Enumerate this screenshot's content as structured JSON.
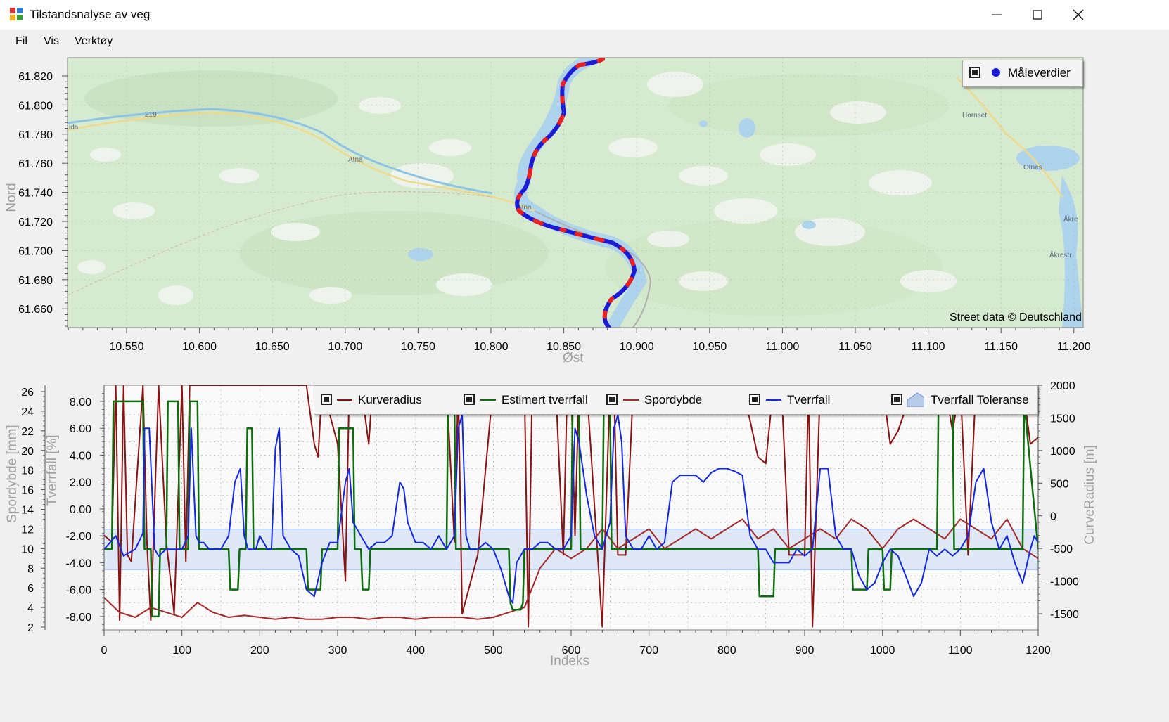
{
  "window": {
    "title": "Tilstandsnalyse av veg",
    "controls": {
      "minimize": "minimize-icon",
      "maximize": "maximize-icon",
      "close": "close-icon"
    }
  },
  "menu": {
    "items": [
      "Fil",
      "Vis",
      "Verktøy"
    ]
  },
  "map": {
    "y_axis_label": "Nord",
    "x_axis_label": "Øst",
    "y_ticks": [
      "61.820",
      "61.800",
      "61.780",
      "61.760",
      "61.740",
      "61.720",
      "61.700",
      "61.680",
      "61.660"
    ],
    "x_ticks": [
      "10.550",
      "10.600",
      "10.650",
      "10.700",
      "10.750",
      "10.800",
      "10.850",
      "10.900",
      "10.950",
      "11.000",
      "11.050",
      "11.100",
      "11.150",
      "11.200"
    ],
    "legend_label": "Måleverdier",
    "attribution": "Street data © Deutschland",
    "place_labels": [
      "Atna",
      "Atna",
      "Hornset",
      "Otnes",
      "Åkre",
      "Åkrestr",
      "ida",
      "219"
    ],
    "colors": {
      "land": "#d6ead0",
      "water": "#aed3ec",
      "route_blue": "#1a1ad8",
      "route_red": "#ee1f1f",
      "road": "#efd98a"
    }
  },
  "chart": {
    "legend": [
      "Kurveradius",
      "Estimert tverrfall",
      "Spordybde",
      "Tverrfall",
      "Tverrfall Toleranse"
    ],
    "x_axis_label": "Indeks",
    "x_ticks": [
      "0",
      "100",
      "200",
      "300",
      "400",
      "500",
      "600",
      "700",
      "800",
      "900",
      "1000",
      "1100",
      "1200"
    ],
    "left_axis_outer_label": "Spordybde [mm]",
    "left_axis_outer_ticks": [
      "26",
      "24",
      "22",
      "20",
      "18",
      "16",
      "14",
      "12",
      "10",
      "8",
      "6",
      "4",
      "2"
    ],
    "left_axis_inner_label": "Tverrfall [%]",
    "left_axis_inner_ticks": [
      "8.00",
      "6.00",
      "4.00",
      "2.00",
      "0.00",
      "-2.00",
      "-4.00",
      "-6.00",
      "-8.00"
    ],
    "right_axis_label": "CurveRadius [m]",
    "right_axis_ticks": [
      "2000",
      "1500",
      "1000",
      "500",
      "0",
      "-500",
      "-1000",
      "-1500"
    ],
    "colors": {
      "kurveradius": "#8b1212",
      "estimert": "#0c6e0c",
      "spordybde": "#a52a2a",
      "tverrfall": "#1428e0",
      "toleranse_fill": "#dbe5f5",
      "toleranse_line": "#6d94de"
    }
  },
  "chart_data": {
    "type": "line",
    "x_range": [
      0,
      1200
    ],
    "tverrfall_range": [
      -9,
      9.2
    ],
    "series": [
      {
        "name": "Tverrfall",
        "axis": "Tverrfall [%]",
        "x": [
          0,
          15,
          25,
          40,
          50,
          52,
          58,
          65,
          70,
          80,
          90,
          100,
          108,
          112,
          118,
          122,
          128,
          135,
          140,
          150,
          160,
          168,
          175,
          180,
          185,
          195,
          200,
          210,
          215,
          220,
          225,
          230,
          240,
          250,
          260,
          270,
          280,
          290,
          300,
          310,
          315,
          320,
          330,
          340,
          350,
          360,
          370,
          380,
          385,
          390,
          400,
          410,
          420,
          430,
          440,
          450,
          455,
          460,
          465,
          470,
          480,
          490,
          500,
          510,
          520,
          525,
          530,
          540,
          550,
          560,
          570,
          580,
          590,
          600,
          605,
          610,
          620,
          630,
          640,
          650,
          655,
          660,
          665,
          670,
          680,
          690,
          700,
          710,
          720,
          730,
          740,
          750,
          760,
          770,
          780,
          790,
          800,
          810,
          820,
          830,
          840,
          850,
          860,
          870,
          880,
          890,
          900,
          910,
          920,
          930,
          940,
          950,
          960,
          970,
          980,
          990,
          1000,
          1010,
          1020,
          1030,
          1040,
          1050,
          1060,
          1070,
          1080,
          1090,
          1100,
          1110,
          1120,
          1130,
          1140,
          1150,
          1160,
          1170,
          1180,
          1190,
          1195,
          1200
        ],
        "values": [
          -3.0,
          -2.0,
          -3.5,
          -3.0,
          -1.8,
          6.0,
          6.0,
          -3.0,
          -3.5,
          -3.0,
          -3.0,
          -3.0,
          -2.0,
          6.0,
          -2.0,
          -2.5,
          -2.5,
          -3.0,
          -3.0,
          -3.0,
          -2.0,
          2.0,
          3.0,
          -2.0,
          -3.0,
          -3.0,
          -2.0,
          -3.0,
          -3.0,
          4.5,
          6.0,
          -2.0,
          -3.0,
          -3.5,
          -6.0,
          -6.5,
          -4.0,
          -2.5,
          -2.5,
          2.0,
          3.0,
          -1.0,
          -2.0,
          -3.0,
          -2.5,
          -2.5,
          -2.0,
          2.0,
          1.5,
          -1.0,
          -2.5,
          -2.5,
          -3.0,
          -2.0,
          -3.0,
          -2.0,
          6.0,
          7.0,
          -2.0,
          -3.0,
          -3.0,
          -2.5,
          -3.0,
          -4.5,
          -6.5,
          -7.0,
          -4.0,
          -3.0,
          -3.0,
          -2.5,
          -2.5,
          -3.0,
          -3.0,
          -2.0,
          6.0,
          5.0,
          1.0,
          -2.0,
          -3.0,
          -1.0,
          6.0,
          7.0,
          5.0,
          -2.0,
          -3.0,
          -3.0,
          -2.0,
          -3.0,
          -2.5,
          2.0,
          2.5,
          2.5,
          2.5,
          2.0,
          2.7,
          3.0,
          3.0,
          2.8,
          2.5,
          -2.0,
          -3.0,
          -3.0,
          -4.0,
          -4.0,
          -4.0,
          -3.0,
          -3.5,
          -3.0,
          3.0,
          3.0,
          -2.0,
          -3.0,
          -3.0,
          -5.0,
          -6.0,
          -5.5,
          -4.0,
          -3.0,
          -3.5,
          -5.0,
          -6.5,
          -5.5,
          -3.0,
          -3.5,
          -3.0,
          -3.5,
          -3.0,
          -2.0,
          2.0,
          3.0,
          -1.0,
          -3.0,
          -2.0,
          -4.0,
          -5.5,
          -3.0,
          -2.0,
          -2.5
        ]
      },
      {
        "name": "Estimert tverrfall",
        "axis": "Tverrfall [%]",
        "x": [
          0,
          10,
          12,
          50,
          52,
          60,
          62,
          70,
          72,
          80,
          82,
          95,
          97,
          108,
          110,
          120,
          122,
          125,
          127,
          160,
          162,
          172,
          174,
          182,
          184,
          190,
          192,
          200,
          202,
          212,
          214,
          222,
          224,
          230,
          232,
          260,
          262,
          265,
          270,
          278,
          280,
          300,
          302,
          320,
          322,
          330,
          332,
          340,
          342,
          350,
          352,
          440,
          442,
          450,
          452,
          460,
          462,
          520,
          522,
          525,
          535,
          538,
          540,
          600,
          602,
          610,
          612,
          640,
          642,
          650,
          652,
          660,
          662,
          665,
          667,
          800,
          802,
          840,
          842,
          850,
          852,
          860,
          862,
          880,
          882,
          900,
          902,
          960,
          962,
          970,
          972,
          980,
          982,
          1000,
          1002,
          1010,
          1012,
          1030,
          1032,
          1070,
          1072,
          1090,
          1092,
          1100,
          1102,
          1120,
          1122,
          1180,
          1182,
          1200
        ],
        "values": [
          -3.0,
          -3.0,
          8.0,
          8.0,
          -3.0,
          -3.0,
          -8.0,
          -8.0,
          -3.0,
          -3.0,
          8.0,
          8.0,
          -3.0,
          -3.0,
          8.0,
          8.0,
          -3.0,
          -3.0,
          -3.0,
          -3.0,
          -6.0,
          -6.0,
          -3.0,
          -3.0,
          6.0,
          6.0,
          -3.0,
          -3.0,
          -3.0,
          -3.0,
          -3.0,
          -3.0,
          -3.0,
          -3.0,
          -3.0,
          -3.0,
          -6.0,
          -6.0,
          -6.0,
          -6.0,
          -3.0,
          -3.0,
          6.0,
          6.0,
          -3.0,
          -3.0,
          -6.0,
          -6.0,
          -3.0,
          -3.0,
          -3.0,
          -3.0,
          8.0,
          8.0,
          -3.0,
          -3.0,
          -3.0,
          -3.0,
          -7.0,
          -7.5,
          -7.5,
          -7.0,
          -3.0,
          -3.0,
          8.0,
          8.0,
          -3.0,
          -3.0,
          8.0,
          8.0,
          -3.0,
          -3.0,
          -3.0,
          -3.0,
          -3.0,
          -3.0,
          -3.0,
          -3.0,
          -6.5,
          -6.5,
          -6.5,
          -6.5,
          -3.0,
          -3.0,
          -3.0,
          -3.0,
          -3.0,
          -3.0,
          -6.0,
          -6.0,
          -6.0,
          -6.0,
          -3.0,
          -3.0,
          -6.0,
          -6.0,
          -3.0,
          -3.0,
          -3.0,
          -3.0,
          8.0,
          8.0,
          -3.0,
          -3.0,
          -3.0,
          -3.0,
          -3.0,
          -3.0,
          8.0,
          -3.0
        ]
      },
      {
        "name": "Spordybde",
        "axis": "Spordybde [mm]",
        "x": [
          0,
          20,
          40,
          60,
          80,
          100,
          120,
          140,
          160,
          180,
          200,
          220,
          240,
          260,
          280,
          300,
          320,
          340,
          360,
          380,
          400,
          420,
          440,
          460,
          480,
          500,
          520,
          540,
          560,
          580,
          600,
          620,
          640,
          660,
          680,
          700,
          720,
          740,
          760,
          780,
          800,
          820,
          840,
          860,
          880,
          900,
          920,
          940,
          960,
          980,
          1000,
          1020,
          1040,
          1060,
          1080,
          1100,
          1120,
          1140,
          1160,
          1180,
          1200
        ],
        "values": [
          5.0,
          3.5,
          3.0,
          4.0,
          3.5,
          3.0,
          4.5,
          3.5,
          3.0,
          3.2,
          3.0,
          2.8,
          3.0,
          2.8,
          2.8,
          3.0,
          3.0,
          2.8,
          3.0,
          3.0,
          2.8,
          3.0,
          3.0,
          3.0,
          2.8,
          3.0,
          3.5,
          4.0,
          8.0,
          10.0,
          9.0,
          10.0,
          12.0,
          10.0,
          11.0,
          12.0,
          10.0,
          11.0,
          12.0,
          11.0,
          12.0,
          13.0,
          11.0,
          12.0,
          10.0,
          11.0,
          12.0,
          11.0,
          13.0,
          12.0,
          10.0,
          12.0,
          13.0,
          12.0,
          11.0,
          13.0,
          12.0,
          11.0,
          13.0,
          10.0,
          9.0
        ]
      },
      {
        "name": "Kurveradius",
        "axis": "CurveRadius [m]",
        "x": [
          0,
          10,
          15,
          20,
          25,
          30,
          35,
          50,
          55,
          60,
          70,
          80,
          90,
          100,
          105,
          110,
          115,
          120,
          140,
          160,
          170,
          180,
          200,
          220,
          240,
          260,
          270,
          275,
          280,
          300,
          310,
          315,
          320,
          330,
          340,
          345,
          350,
          380,
          400,
          420,
          440,
          450,
          455,
          460,
          480,
          500,
          520,
          530,
          540,
          545,
          550,
          580,
          590,
          595,
          600,
          605,
          610,
          620,
          640,
          650,
          655,
          660,
          670,
          680,
          700,
          720,
          740,
          760,
          780,
          800,
          820,
          840,
          850,
          860,
          870,
          880,
          900,
          905,
          910,
          920,
          940,
          960,
          980,
          1000,
          1010,
          1020,
          1040,
          1060,
          1080,
          1090,
          1100,
          1110,
          1120,
          1140,
          1160,
          1180,
          1190,
          1200
        ],
        "values": [
          -300,
          -400,
          2000,
          -1600,
          2000,
          -600,
          -700,
          2000,
          -400,
          -1600,
          2000,
          -400,
          -1500,
          2000,
          -700,
          2000,
          2000,
          2000,
          2000,
          2000,
          2000,
          2000,
          2000,
          2000,
          2000,
          2000,
          1100,
          900,
          2000,
          1100,
          -1000,
          2000,
          2000,
          2000,
          1100,
          2000,
          2000,
          2000,
          2000,
          2000,
          2000,
          -400,
          2000,
          -1500,
          -600,
          2000,
          2000,
          2000,
          2000,
          -1700,
          2000,
          2000,
          -600,
          2000,
          2000,
          -300,
          2000,
          2000,
          -1700,
          2000,
          2000,
          -600,
          -600,
          2000,
          2000,
          2000,
          2000,
          2000,
          2000,
          2000,
          2000,
          900,
          800,
          2000,
          2000,
          -600,
          -600,
          2000,
          -1700,
          2000,
          2000,
          2000,
          2000,
          2000,
          1100,
          1300,
          2000,
          2000,
          2000,
          1300,
          2000,
          -600,
          2000,
          2000,
          2000,
          2000,
          1100,
          1200
        ]
      },
      {
        "name": "Tverrfall Toleranse",
        "axis": "Tverrfall [%]",
        "x": [
          0,
          1200
        ],
        "lower": [
          -4.5,
          -4.5
        ],
        "upper": [
          -1.5,
          -1.5
        ]
      }
    ]
  }
}
